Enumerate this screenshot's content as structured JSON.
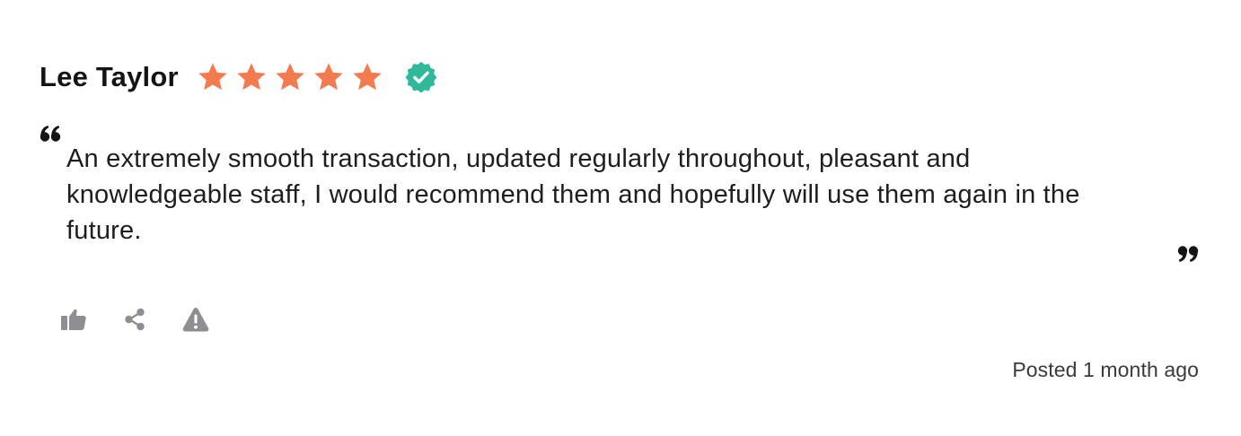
{
  "review": {
    "reviewer_name": "Lee Taylor",
    "rating": 5,
    "rating_max": 5,
    "verified_icon": "verified-badge-icon",
    "text": "An extremely smooth transaction, updated regularly throughout, pleasant and knowledgeable staff, I would recommend them and hopefully will use them again in the future.",
    "posted": "Posted 1 month ago"
  },
  "actions": [
    {
      "icon": "thumbs-up-icon"
    },
    {
      "icon": "share-icon"
    },
    {
      "icon": "warning-icon"
    }
  ],
  "colors": {
    "star": "#f47b4f",
    "verified": "#2fb99a",
    "icon_gray": "#8e8e93",
    "text": "#1e1e1e"
  }
}
